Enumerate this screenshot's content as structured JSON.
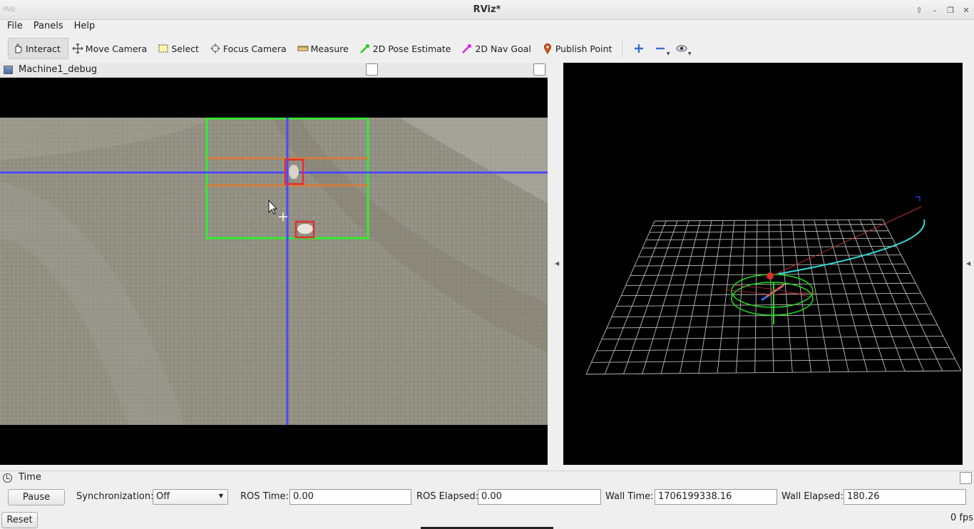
{
  "window": {
    "app_icon": "RViz",
    "title": "RViz*",
    "controls": [
      "up-icon",
      "minimize-icon",
      "maximize-icon",
      "close-icon"
    ]
  },
  "menu": {
    "items": [
      {
        "label": "File",
        "accel": "F"
      },
      {
        "label": "Panels",
        "accel": "P"
      },
      {
        "label": "Help",
        "accel": "H"
      }
    ]
  },
  "toolbar": {
    "interact": "Interact",
    "move_camera": "Move Camera",
    "select": "Select",
    "focus_camera": "Focus Camera",
    "measure": "Measure",
    "pose_estimate": "2D Pose Estimate",
    "nav_goal": "2D Nav Goal",
    "publish_point": "Publish Point"
  },
  "image_panel": {
    "title": "Machine1_debug"
  },
  "time_panel": {
    "title": "Time",
    "pause_label": "Pause",
    "sync_label": "Synchronization:",
    "sync_value": "Off",
    "ros_time_label": "ROS Time:",
    "ros_time_value": "0.00",
    "ros_elapsed_label": "ROS Elapsed:",
    "ros_elapsed_value": "0.00",
    "wall_time_label": "Wall Time:",
    "wall_time_value": "1706199338.16",
    "wall_elapsed_label": "Wall Elapsed:",
    "wall_elapsed_value": "180.26"
  },
  "status": {
    "reset_label": "Reset",
    "fps": "0 fps"
  },
  "colors": {
    "detection_box": "#e03030",
    "target_box": "#33ee33",
    "crosshair": "#4a4aff",
    "band": "#e07a30",
    "trajectory": "#33dddd"
  }
}
